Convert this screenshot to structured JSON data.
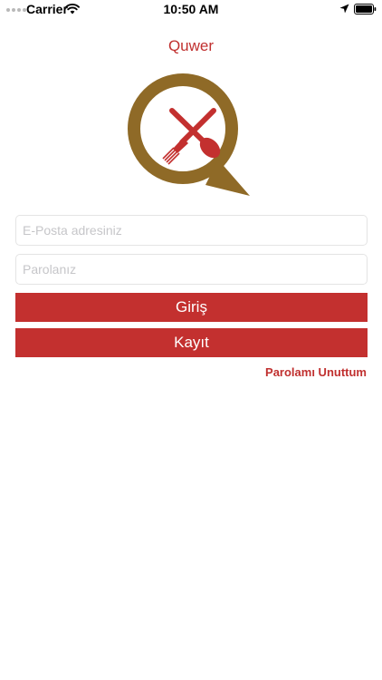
{
  "status_bar": {
    "carrier": "Carrier",
    "time": "10:50 AM",
    "icons": [
      "signal-dots-icon",
      "wifi-icon",
      "location-arrow-icon",
      "battery-icon"
    ]
  },
  "app": {
    "title": "Quwer",
    "logo_icon": "fork-spoon-chat-bubble-icon"
  },
  "form": {
    "email_placeholder": "E-Posta adresiniz",
    "email_value": "",
    "password_placeholder": "Parolanız",
    "password_value": "",
    "login_label": "Giriş",
    "register_label": "Kayıt",
    "forgot_label": "Parolamı Unuttum"
  },
  "colors": {
    "accent": "#c3302f",
    "logo_ring": "#8f6a27",
    "background": "#ffffff"
  }
}
